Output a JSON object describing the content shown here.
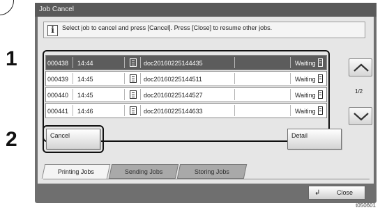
{
  "callouts": {
    "one": "1",
    "two": "2"
  },
  "window": {
    "title": "Job Cancel"
  },
  "message": {
    "text": "Select job to cancel and press [Cancel]. Press [Close] to resume other jobs."
  },
  "jobs": [
    {
      "id": "000438",
      "time": "14:44",
      "name": "doc20160225144435",
      "status": "Waiting",
      "selected": true
    },
    {
      "id": "000439",
      "time": "14:45",
      "name": "doc20160225144511",
      "status": "Waiting",
      "selected": false
    },
    {
      "id": "000440",
      "time": "14:45",
      "name": "doc20160225144527",
      "status": "Waiting",
      "selected": false
    },
    {
      "id": "000441",
      "time": "14:46",
      "name": "doc20160225144633",
      "status": "Waiting",
      "selected": false
    }
  ],
  "pagination": {
    "indicator": "1/2"
  },
  "buttons": {
    "cancel": "Cancel",
    "detail": "Detail",
    "close": "Close"
  },
  "tabs": [
    {
      "label": "Printing Jobs",
      "active": true
    },
    {
      "label": "Sending Jobs",
      "active": false
    },
    {
      "label": "Storing Jobs",
      "active": false
    }
  ],
  "footer": {
    "code": "t050601"
  }
}
